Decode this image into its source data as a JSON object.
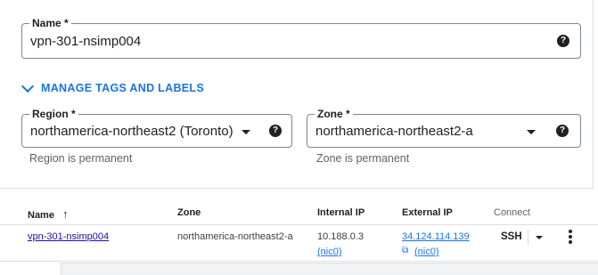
{
  "form": {
    "name": {
      "label": "Name *",
      "value": "vpn-301-nsimp004",
      "help": "?"
    },
    "manage_tags_label": "MANAGE TAGS AND LABELS",
    "region": {
      "label": "Region *",
      "value": "northamerica-northeast2 (Toronto)",
      "hint": "Region is permanent",
      "help": "?"
    },
    "zone": {
      "label": "Zone *",
      "value": "northamerica-northeast2-a",
      "hint": "Zone is permanent",
      "help": "?"
    }
  },
  "table": {
    "headers": {
      "name": "Name",
      "sort_arrow": "↑",
      "zone": "Zone",
      "internal_ip": "Internal IP",
      "external_ip": "External IP",
      "connect": "Connect"
    },
    "rows": [
      {
        "name": "vpn-301-nsimp004",
        "zone": "northamerica-northeast2-a",
        "internal_ip": "10.188.0.3",
        "internal_nic": "(nic0)",
        "external_ip": "34.124.114.139",
        "external_nic": "(nic0)",
        "connect": "SSH"
      }
    ]
  },
  "colors": {
    "accent": "#1a73e8",
    "text": "#202124",
    "muted": "#5f6368",
    "border": "#dadce0"
  }
}
